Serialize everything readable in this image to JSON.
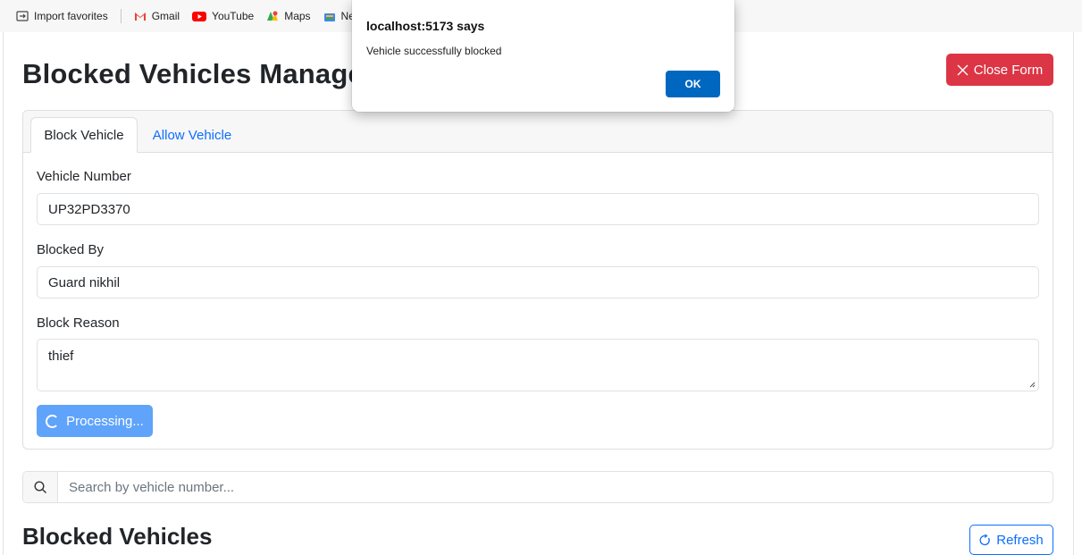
{
  "bookmarks": {
    "items": [
      {
        "label": "Import favorites",
        "icon": "import-favorites-icon"
      },
      {
        "label": "Gmail",
        "icon": "gmail-icon"
      },
      {
        "label": "YouTube",
        "icon": "youtube-icon"
      },
      {
        "label": "Maps",
        "icon": "maps-icon"
      },
      {
        "label": "New",
        "icon": "news-icon"
      }
    ]
  },
  "page": {
    "title": "Blocked Vehicles Management",
    "close_form_label": "Close Form"
  },
  "tabs": [
    {
      "label": "Block Vehicle",
      "active": true
    },
    {
      "label": "Allow Vehicle",
      "active": false
    }
  ],
  "form": {
    "vehicle_number_label": "Vehicle Number",
    "vehicle_number_value": "UP32PD3370",
    "blocked_by_label": "Blocked By",
    "blocked_by_value": "Guard nikhil",
    "block_reason_label": "Block Reason",
    "block_reason_value": "thief",
    "submit_label": "Processing..."
  },
  "search": {
    "placeholder": "Search by vehicle number..."
  },
  "list": {
    "title": "Blocked Vehicles",
    "refresh_label": "Refresh"
  },
  "dialog": {
    "title": "localhost:5173 says",
    "message": "Vehicle successfully blocked",
    "ok_label": "OK"
  },
  "colors": {
    "danger": "#dc3545",
    "primary": "#0d6efd",
    "dialog_ok": "#0067c0"
  }
}
